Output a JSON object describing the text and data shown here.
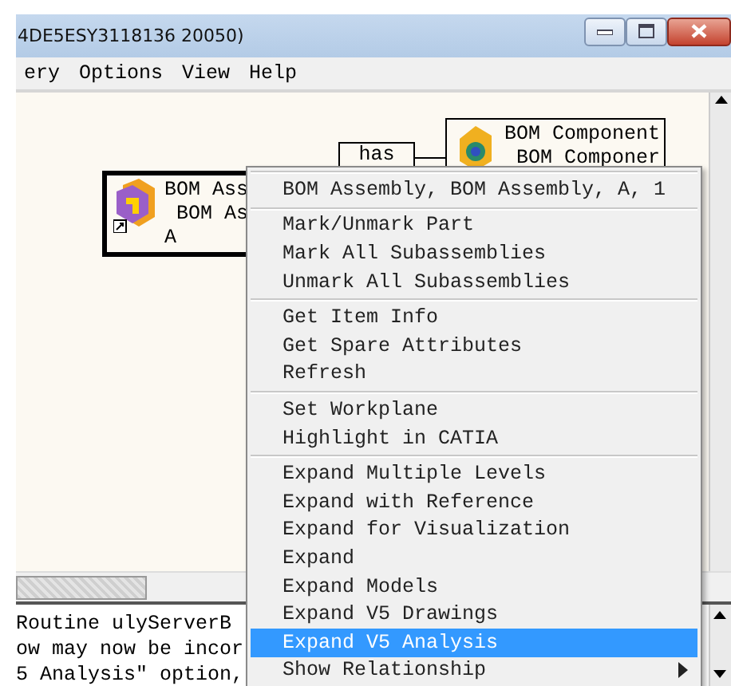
{
  "window": {
    "title": "4DE5ESY3118136 20050)"
  },
  "menu_bar": [
    {
      "label": "ery"
    },
    {
      "label": "Options"
    },
    {
      "label": "View"
    },
    {
      "label": "Help"
    }
  ],
  "diagram": {
    "nodes": [
      {
        "kind": "assembly",
        "lines": [
          "BOM Ass",
          "BOM As",
          "A"
        ]
      },
      {
        "kind": "relation",
        "lines": [
          "has"
        ]
      },
      {
        "kind": "component",
        "lines": [
          "BOM Component",
          "BOM Componer"
        ]
      }
    ]
  },
  "log": {
    "lines": [
      "Routine ulyServerB",
      "ow may now be incor",
      "5 Analysis\" option,"
    ]
  },
  "context_menu": {
    "sections": [
      {
        "items": [
          {
            "label": "BOM Assembly, BOM Assembly, A, 1",
            "selected": false,
            "submenu": false
          }
        ]
      },
      {
        "items": [
          {
            "label": "Mark/Unmark Part",
            "selected": false,
            "submenu": false
          },
          {
            "label": "Mark All Subassemblies",
            "selected": false,
            "submenu": false
          },
          {
            "label": "Unmark All Subassemblies",
            "selected": false,
            "submenu": false
          }
        ]
      },
      {
        "items": [
          {
            "label": "Get Item Info",
            "selected": false,
            "submenu": false
          },
          {
            "label": "Get Spare Attributes",
            "selected": false,
            "submenu": false
          },
          {
            "label": "Refresh",
            "selected": false,
            "submenu": false
          }
        ]
      },
      {
        "items": [
          {
            "label": "Set Workplane",
            "selected": false,
            "submenu": false
          },
          {
            "label": "Highlight in CATIA",
            "selected": false,
            "submenu": false
          }
        ]
      },
      {
        "items": [
          {
            "label": "Expand Multiple Levels",
            "selected": false,
            "submenu": false
          },
          {
            "label": "Expand with Reference",
            "selected": false,
            "submenu": false
          },
          {
            "label": "Expand for Visualization",
            "selected": false,
            "submenu": false
          },
          {
            "label": "Expand",
            "selected": false,
            "submenu": false
          },
          {
            "label": "Expand Models",
            "selected": false,
            "submenu": false
          },
          {
            "label": "Expand V5 Drawings",
            "selected": false,
            "submenu": false
          },
          {
            "label": "Expand V5 Analysis",
            "selected": true,
            "submenu": false
          },
          {
            "label": "Show Relationship",
            "selected": false,
            "submenu": true
          }
        ]
      }
    ]
  }
}
